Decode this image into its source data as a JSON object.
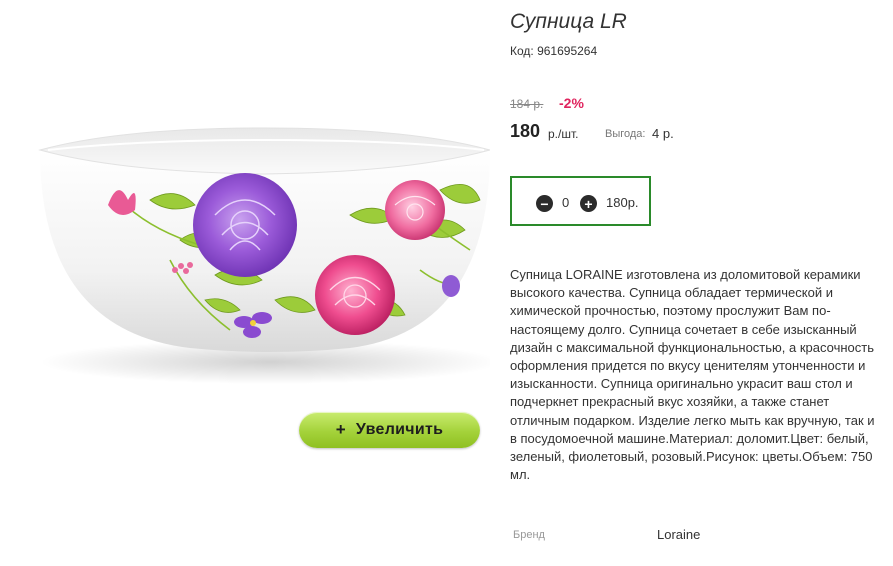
{
  "product": {
    "title": "Супница LR",
    "code": "Код: 961695264",
    "old_price": "184 р.",
    "discount": "-2%",
    "price": "180",
    "price_unit": "р./шт.",
    "savings_label": "Выгода:",
    "savings_value": "4 р.",
    "description": "Супница LORAINE изготовлена из доломитовой керамики высокого качества. Супница обладает термической и химической прочностью, поэтому прослужит Вам по-настоящему долго. Супница сочетает в себе изысканный дизайн с максимальной функциональностью, а красочность оформления придется по вкусу ценителям утонченности и изысканности. Супница оригинально украсит ваш стол и подчеркнет прекрасный вкус хозяйки, а также станет отличным подарком. Изделие легко мыть как вручную, так и в посудомоечной машине.Материал: доломит.Цвет: белый, зеленый, фиолетовый, розовый.Рисунок: цветы.Объем: 750 мл.",
    "brand_label": "Бренд",
    "brand_value": "Loraine"
  },
  "zoom_button": {
    "icon": "+",
    "label": "Увеличить"
  },
  "quantity": {
    "minus_icon": "minus-circle-icon",
    "plus_icon": "plus-circle-icon",
    "value": "0",
    "total": "180р."
  },
  "colors": {
    "accent_green": "#2a8a2a",
    "discount_red": "#e0245e",
    "button_green": "#a4d23a"
  }
}
